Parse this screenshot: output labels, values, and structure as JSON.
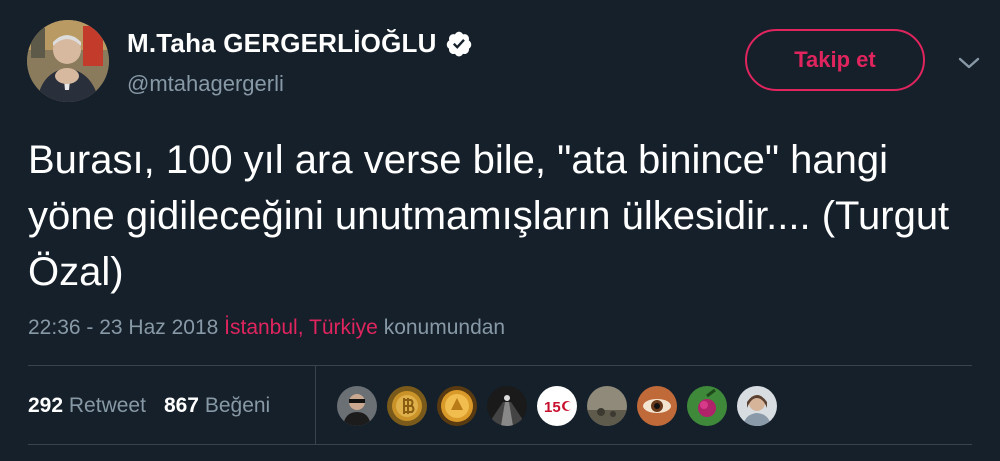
{
  "author": {
    "display_name": "M.Taha GERGERLİOĞLU",
    "handle": "@mtahagergerli",
    "verified": true
  },
  "follow_button": {
    "label": "Takip et"
  },
  "tweet": {
    "text": "Burası, 100 yıl ara verse bile, \"ata binince\" hangi yöne gidileceğini unutmamışların ülkesidir.... (Turgut Özal)",
    "timestamp": "22:36 - 23 Haz 2018",
    "location": "İstanbul, Türkiye",
    "location_suffix": "konumundan"
  },
  "stats": {
    "retweets_count": "292",
    "retweets_label": "Retweet",
    "likes_count": "867",
    "likes_label": "Beğeni"
  },
  "liker_avatars": [
    "liker-1",
    "liker-2",
    "liker-3",
    "liker-4",
    "liker-5",
    "liker-6",
    "liker-7",
    "liker-8",
    "liker-9"
  ],
  "icons": {
    "verified": "verified-badge-icon",
    "menu": "chevron-down-icon"
  },
  "colors": {
    "background": "#15202b",
    "text": "#ffffff",
    "secondary": "#8899a6",
    "accent": "#e0245e",
    "divider": "#38444d"
  }
}
